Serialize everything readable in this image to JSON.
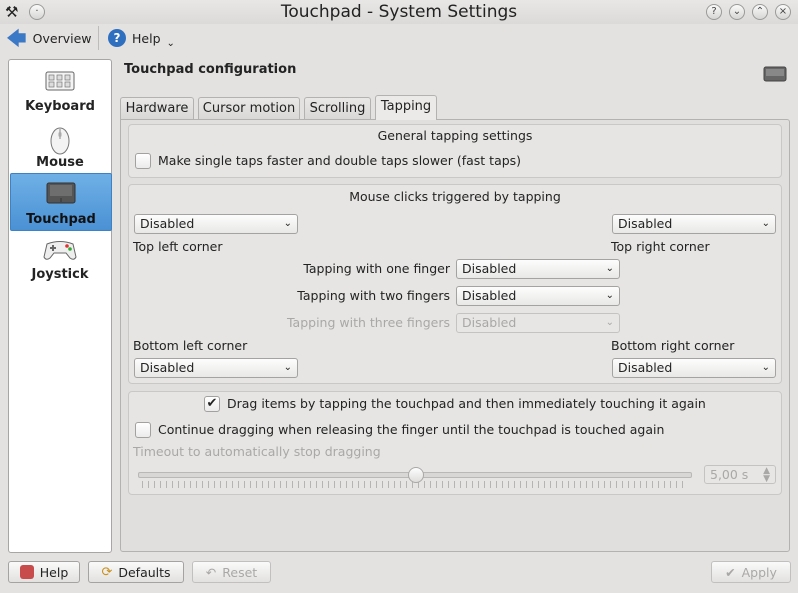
{
  "window": {
    "title": "Touchpad - System Settings"
  },
  "toolbar": {
    "overview_label": "Overview",
    "help_label": "Help"
  },
  "sidebar": {
    "items": [
      {
        "label": "Keyboard",
        "selected": false
      },
      {
        "label": "Mouse",
        "selected": false
      },
      {
        "label": "Touchpad",
        "selected": true
      },
      {
        "label": "Joystick",
        "selected": false
      }
    ]
  },
  "page": {
    "title": "Touchpad configuration"
  },
  "tabs": [
    "Hardware",
    "Cursor motion",
    "Scrolling",
    "Tapping"
  ],
  "general": {
    "title": "General tapping settings",
    "fast_taps_label": "Make single taps faster and double taps slower (fast taps)",
    "fast_taps_checked": false
  },
  "clicks": {
    "title": "Mouse clicks triggered by tapping",
    "top_left_value": "Disabled",
    "top_left_label": "Top left corner",
    "top_right_value": "Disabled",
    "top_right_label": "Top right corner",
    "one_finger_label": "Tapping with one finger",
    "one_finger_value": "Disabled",
    "two_fingers_label": "Tapping with two fingers",
    "two_fingers_value": "Disabled",
    "three_fingers_label": "Tapping with three fingers",
    "three_fingers_value": "Disabled",
    "bottom_left_label": "Bottom left corner",
    "bottom_left_value": "Disabled",
    "bottom_right_label": "Bottom right corner",
    "bottom_right_value": "Disabled"
  },
  "drag": {
    "drag_label": "Drag items by tapping the touchpad and then immediately touching it again",
    "drag_checked": true,
    "continue_label": "Continue dragging when releasing the finger until the touchpad is touched again",
    "continue_checked": false,
    "timeout_label": "Timeout to automatically stop dragging",
    "timeout_value": "5,00 s",
    "slider_fraction": 0.5
  },
  "buttons": {
    "help": "Help",
    "defaults": "Defaults",
    "reset": "Reset",
    "apply": "Apply"
  }
}
